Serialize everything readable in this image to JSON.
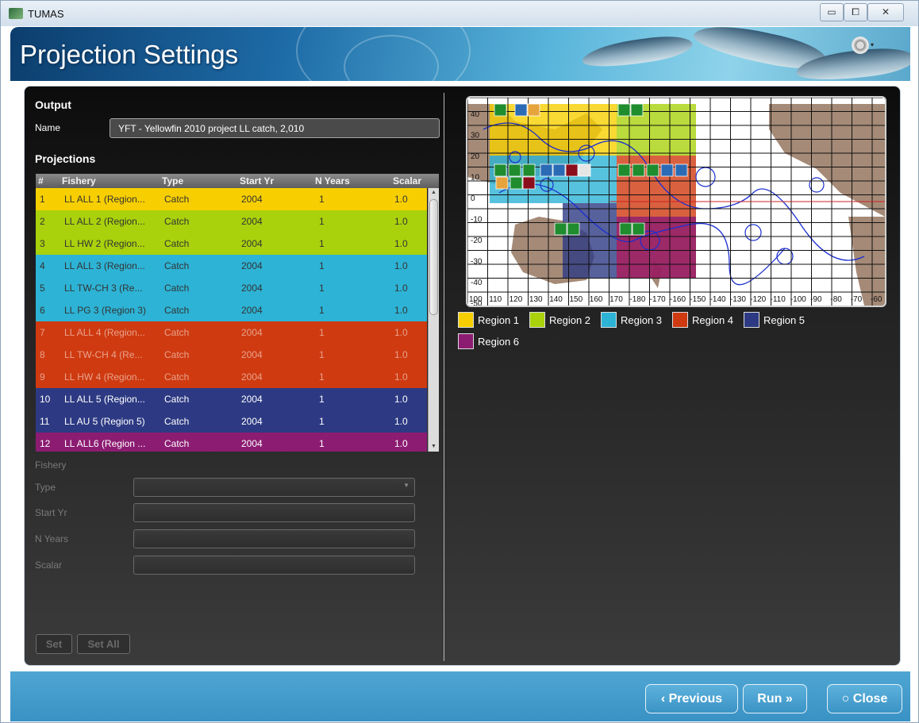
{
  "window": {
    "title": "TUMAS",
    "minimize": "▭",
    "maximize": "⧠",
    "close": "✕"
  },
  "header": {
    "title": "Projection Settings",
    "gear_icon": "gear-icon",
    "gear_caret": "▾"
  },
  "output": {
    "section_title": "Output",
    "name_label": "Name",
    "name_value": "YFT - Yellowfin 2010 project LL catch, 2,010"
  },
  "projections": {
    "section_title": "Projections",
    "columns": [
      "#",
      "Fishery",
      "Type",
      "Start Yr",
      "N Years",
      "Scalar"
    ],
    "rows": [
      {
        "num": "1",
        "fishery": "LL ALL 1 (Region...",
        "type": "Catch",
        "start": "2004",
        "nyears": "1",
        "scalar": "1.0",
        "bg": "#f7cf00",
        "fg": "#333333"
      },
      {
        "num": "2",
        "fishery": "LL ALL 2 (Region...",
        "type": "Catch",
        "start": "2004",
        "nyears": "1",
        "scalar": "1.0",
        "bg": "#a9d20c",
        "fg": "#333333"
      },
      {
        "num": "3",
        "fishery": "LL HW 2 (Region...",
        "type": "Catch",
        "start": "2004",
        "nyears": "1",
        "scalar": "1.0",
        "bg": "#a9d20c",
        "fg": "#333333"
      },
      {
        "num": "4",
        "fishery": "LL ALL 3 (Region...",
        "type": "Catch",
        "start": "2004",
        "nyears": "1",
        "scalar": "1.0",
        "bg": "#2db3d5",
        "fg": "#333333"
      },
      {
        "num": "5",
        "fishery": "LL TW-CH 3 (Re...",
        "type": "Catch",
        "start": "2004",
        "nyears": "1",
        "scalar": "1.0",
        "bg": "#2db3d5",
        "fg": "#333333"
      },
      {
        "num": "6",
        "fishery": "LL PG 3 (Region 3)",
        "type": "Catch",
        "start": "2004",
        "nyears": "1",
        "scalar": "1.0",
        "bg": "#2db3d5",
        "fg": "#333333"
      },
      {
        "num": "7",
        "fishery": "LL ALL 4 (Region...",
        "type": "Catch",
        "start": "2004",
        "nyears": "1",
        "scalar": "1.0",
        "bg": "#cf3a10",
        "fg": "#e8a28c"
      },
      {
        "num": "8",
        "fishery": "LL TW-CH 4 (Re...",
        "type": "Catch",
        "start": "2004",
        "nyears": "1",
        "scalar": "1.0",
        "bg": "#cf3a10",
        "fg": "#e8a28c"
      },
      {
        "num": "9",
        "fishery": "LL HW 4 (Region...",
        "type": "Catch",
        "start": "2004",
        "nyears": "1",
        "scalar": "1.0",
        "bg": "#cf3a10",
        "fg": "#e8a28c"
      },
      {
        "num": "10",
        "fishery": "LL ALL 5 (Region...",
        "type": "Catch",
        "start": "2004",
        "nyears": "1",
        "scalar": "1.0",
        "bg": "#2d3a83",
        "fg": "#ffffff"
      },
      {
        "num": "11",
        "fishery": "LL AU 5 (Region 5)",
        "type": "Catch",
        "start": "2004",
        "nyears": "1",
        "scalar": "1.0",
        "bg": "#2d3a83",
        "fg": "#ffffff"
      },
      {
        "num": "12",
        "fishery": "LL ALL6 (Region ...",
        "type": "Catch",
        "start": "2004",
        "nyears": "1",
        "scalar": "1.0",
        "bg": "#8c1c72",
        "fg": "#ffffff"
      }
    ]
  },
  "form": {
    "fishery_label": "Fishery",
    "type_label": "Type",
    "start_label": "Start Yr",
    "nyears_label": "N Years",
    "scalar_label": "Scalar",
    "type_caret": "▼",
    "set_button": "Set",
    "set_all_button": "Set All"
  },
  "map": {
    "lat_labels": [
      "40",
      "30",
      "20",
      "10",
      "0",
      "-10",
      "-20",
      "-30",
      "-40",
      "-50"
    ],
    "lon_labels": [
      "100",
      "110",
      "120",
      "130",
      "140",
      "150",
      "160",
      "170",
      "-180",
      "-170",
      "-160",
      "-150",
      "-140",
      "-130",
      "-120",
      "-110",
      "-100",
      "-90",
      "-80",
      "-70",
      "-60"
    ]
  },
  "legend": [
    {
      "label": "Region 1",
      "color": "#f7cf00"
    },
    {
      "label": "Region 2",
      "color": "#a9d20c"
    },
    {
      "label": "Region 3",
      "color": "#2db3d5"
    },
    {
      "label": "Region 4",
      "color": "#cf3a10"
    },
    {
      "label": "Region 5",
      "color": "#2d3a83"
    },
    {
      "label": "Region 6",
      "color": "#8c1c72"
    }
  ],
  "footer": {
    "previous": "‹ Previous",
    "run": "Run »",
    "close": "○ Close"
  }
}
